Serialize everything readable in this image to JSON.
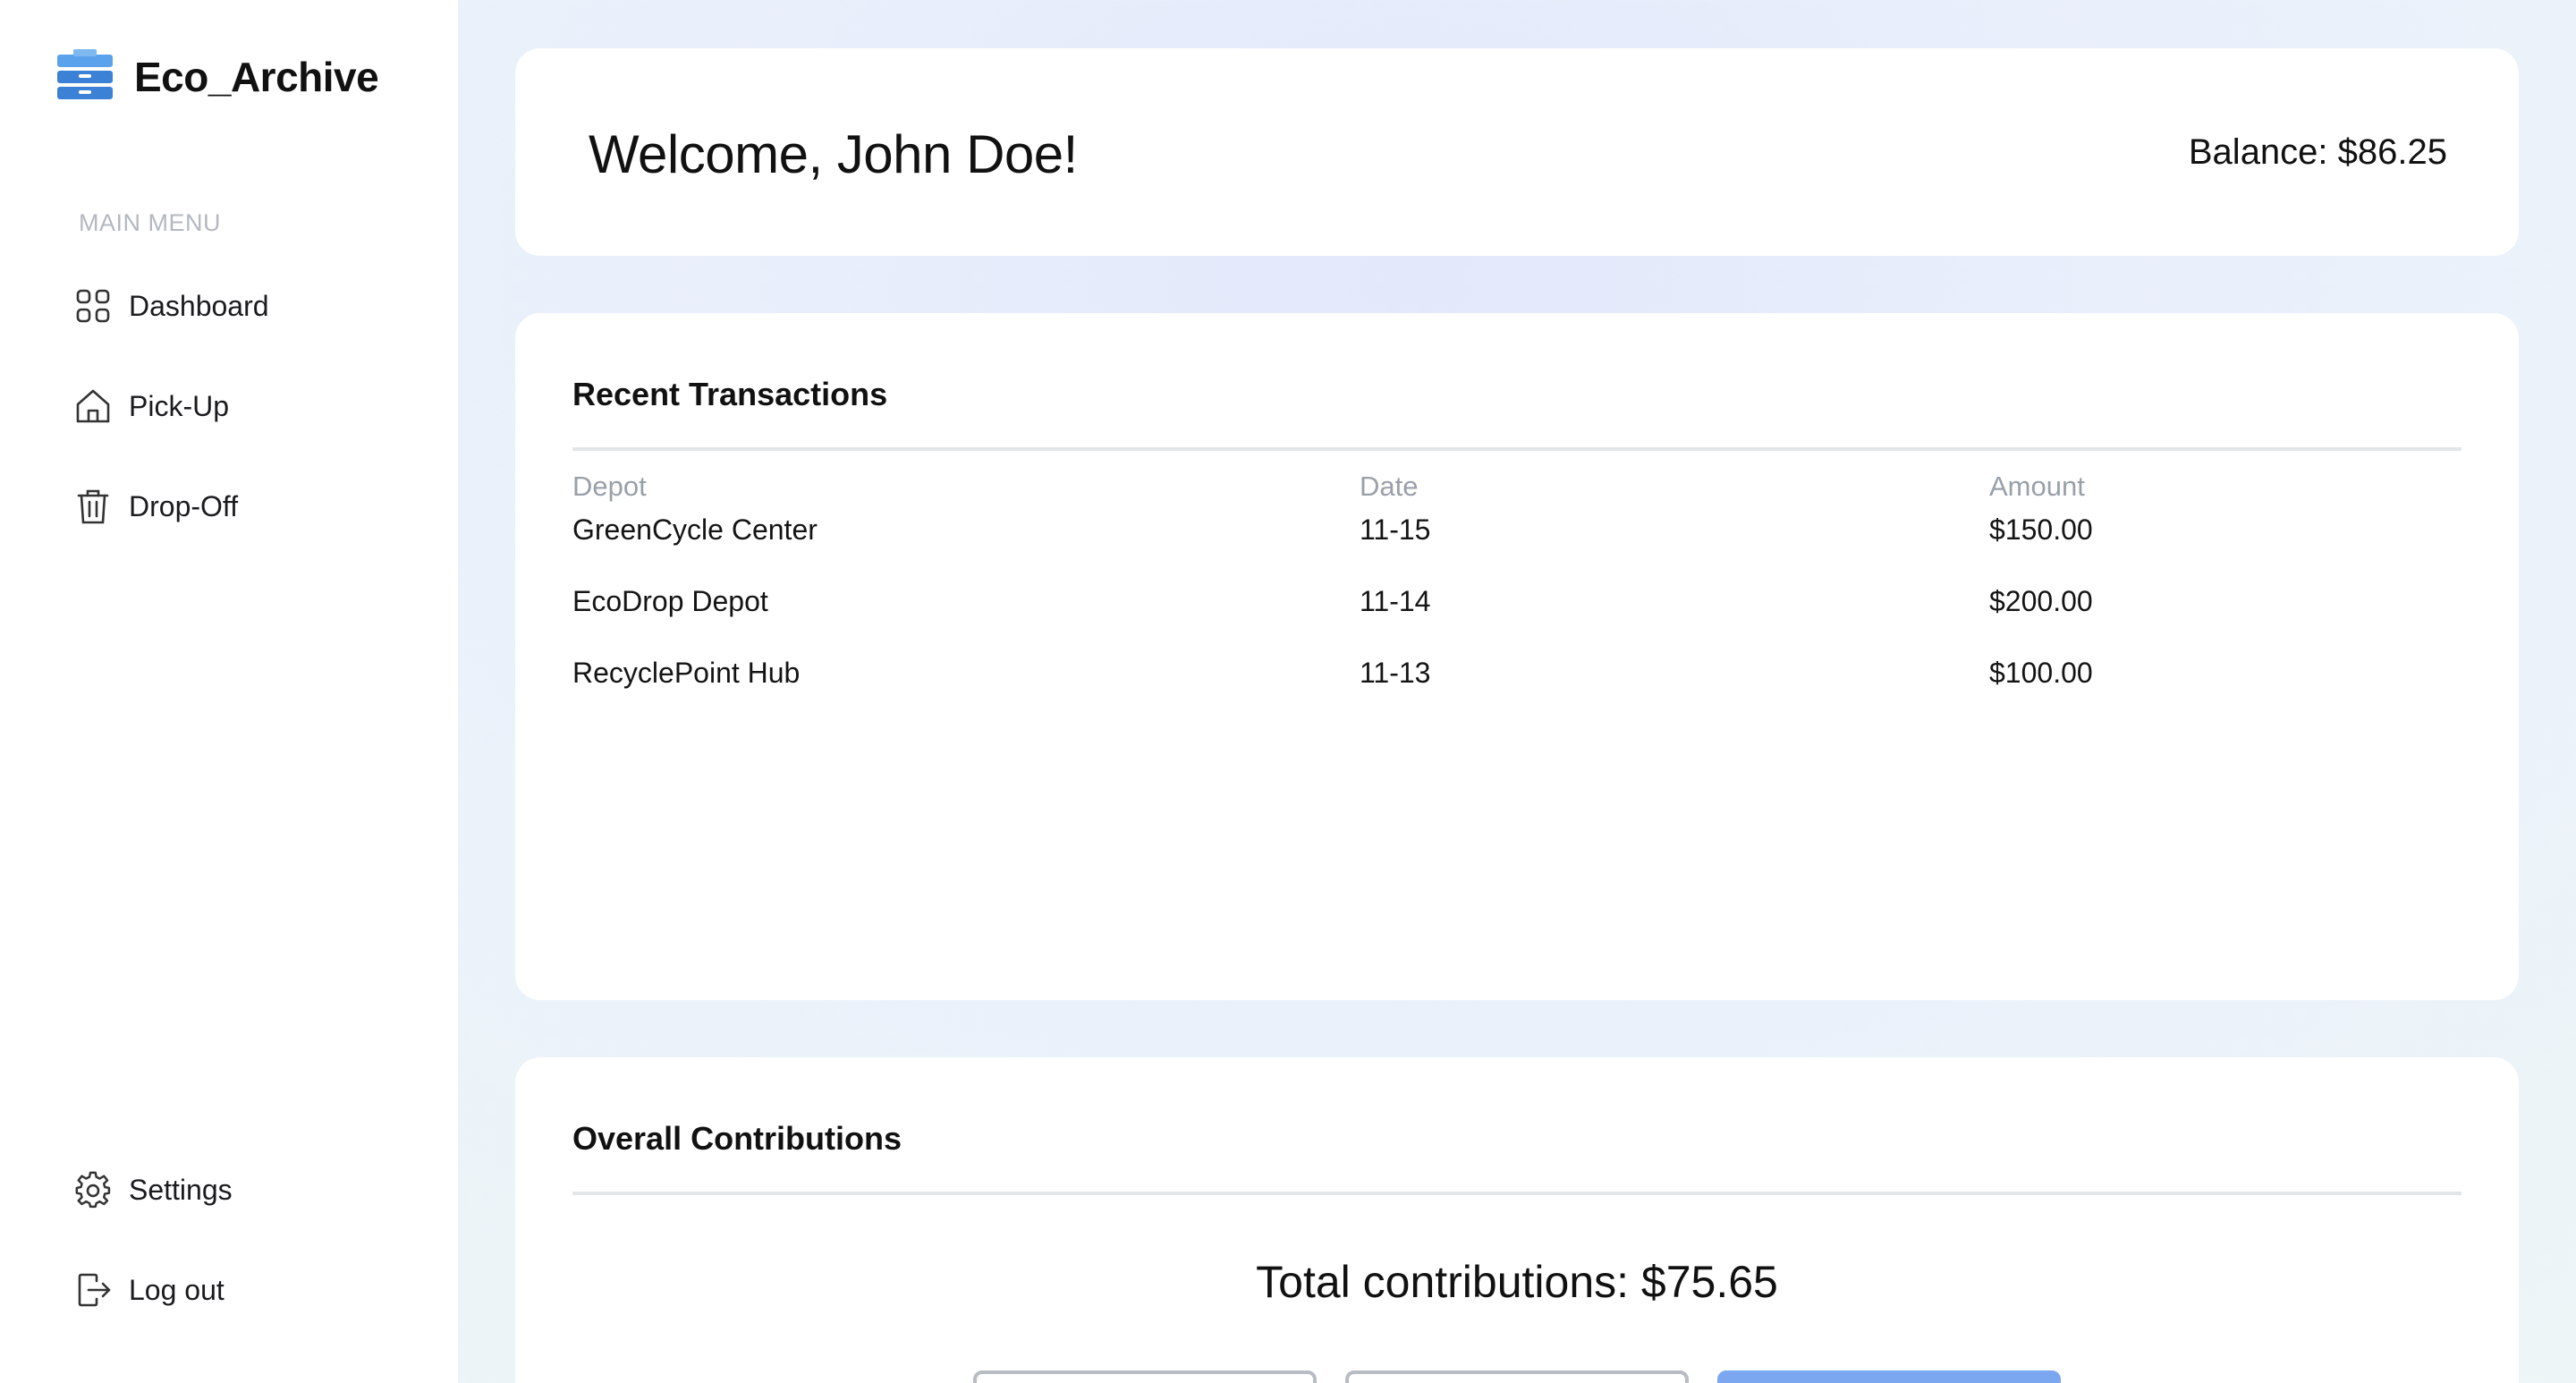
{
  "app": {
    "name": "Eco_Archive"
  },
  "sidebar": {
    "menu_caption": "MAIN MENU",
    "items": [
      {
        "label": "Dashboard",
        "icon": "grid-icon"
      },
      {
        "label": "Pick-Up",
        "icon": "home-icon"
      },
      {
        "label": "Drop-Off",
        "icon": "trash-icon"
      }
    ],
    "bottom_items": [
      {
        "label": "Settings",
        "icon": "gear-icon"
      },
      {
        "label": "Log out",
        "icon": "logout-icon"
      }
    ]
  },
  "welcome": {
    "title": "Welcome, John Doe!",
    "balance": "Balance: $86.25"
  },
  "transactions": {
    "title": "Recent Transactions",
    "columns": [
      "Depot",
      "Date",
      "Amount"
    ],
    "rows": [
      {
        "depot": "GreenCycle Center",
        "date": "11-15",
        "amount": "$150.00"
      },
      {
        "depot": "EcoDrop Depot",
        "date": "11-14",
        "amount": "$200.00"
      },
      {
        "depot": "RecyclePoint Hub",
        "date": "11-13",
        "amount": "$100.00"
      }
    ]
  },
  "contributions": {
    "title": "Overall Contributions",
    "total": "Total contributions: $75.65"
  },
  "colors": {
    "accent": "#7aa7ef",
    "logo_blue": "#3b82d6",
    "muted_text": "#9aa0a9"
  }
}
